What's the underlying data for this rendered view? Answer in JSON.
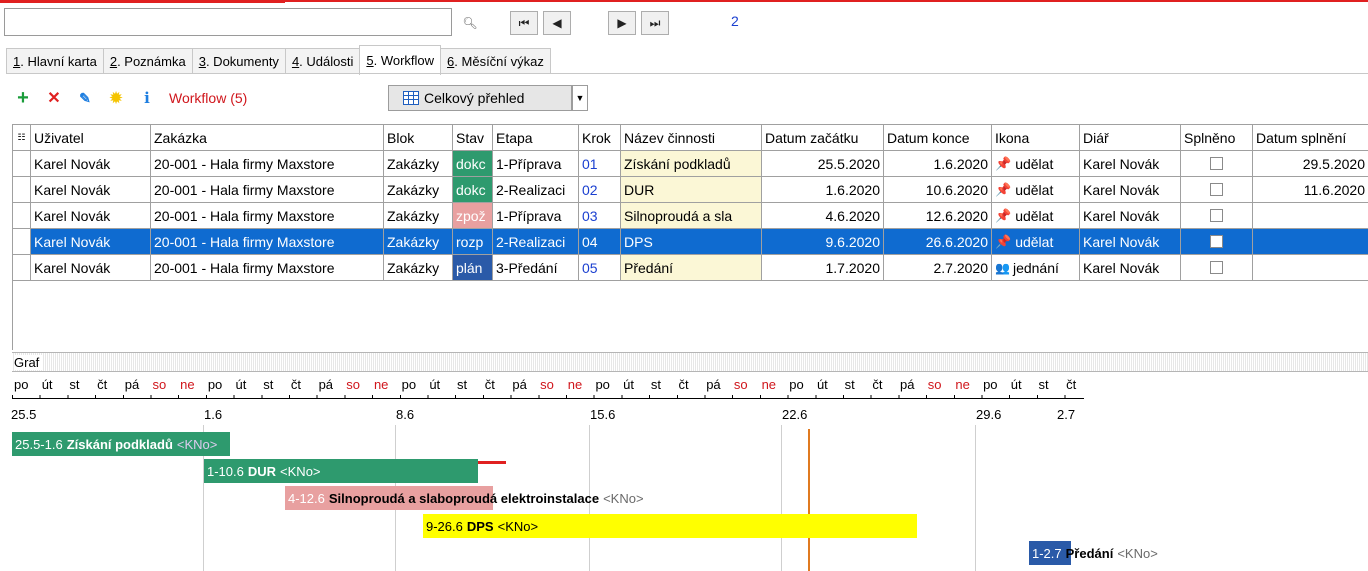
{
  "nav": {
    "page": "2"
  },
  "tabs": [
    {
      "num": "1",
      "label": ". Hlavní karta"
    },
    {
      "num": "2",
      "label": ". Poznámka"
    },
    {
      "num": "3",
      "label": ". Dokumenty"
    },
    {
      "num": "4",
      "label": ". Události"
    },
    {
      "num": "5",
      "label": ". Workflow"
    },
    {
      "num": "6",
      "label": ". Měsíční výkaz"
    }
  ],
  "toolbar": {
    "title": "Workflow (5)",
    "overview": "Celkový přehled"
  },
  "columns": [
    "Uživatel",
    "Zakázka",
    "Blok",
    "Stav",
    "Etapa",
    "Krok",
    "Název činnosti",
    "Datum začátku",
    "Datum konce",
    "Ikona",
    "Diář",
    "Splněno",
    "Datum splnění"
  ],
  "rows": [
    {
      "user": "Karel Novák",
      "order": "20-001 - Hala firmy Maxstore",
      "blok": "Zakázky",
      "stav": "dokc",
      "stav_color": "#2e9a6e",
      "etapa": "1-Příprava",
      "krok": "01",
      "name": "Získání podkladů",
      "start": "25.5.2020",
      "end": "1.6.2020",
      "icon": "udělat",
      "diary": "Karel Novák",
      "done_date": "29.5.2020"
    },
    {
      "user": "Karel Novák",
      "order": "20-001 - Hala firmy Maxstore",
      "blok": "Zakázky",
      "stav": "dokc",
      "stav_color": "#2e9a6e",
      "etapa": "2-Realizaci",
      "krok": "02",
      "name": "DUR",
      "start": "1.6.2020",
      "end": "10.6.2020",
      "icon": "udělat",
      "diary": "Karel Novák",
      "done_date": "11.6.2020"
    },
    {
      "user": "Karel Novák",
      "order": "20-001 - Hala firmy Maxstore",
      "blok": "Zakázky",
      "stav": "zpož",
      "stav_color": "#e8a0a0",
      "etapa": "1-Příprava",
      "krok": "03",
      "name": "Silnoproudá a sla",
      "start": "4.6.2020",
      "end": "12.6.2020",
      "icon": "udělat",
      "diary": "Karel Novák",
      "done_date": ""
    },
    {
      "user": "Karel Novák",
      "order": "20-001 - Hala firmy Maxstore",
      "blok": "Zakázky",
      "stav": "rozp",
      "stav_color": "#0f6bd0",
      "etapa": "2-Realizaci",
      "krok": "04",
      "name": "DPS",
      "start": "9.6.2020",
      "end": "26.6.2020",
      "icon": "udělat",
      "diary": "Karel Novák",
      "done_date": ""
    },
    {
      "user": "Karel Novák",
      "order": "20-001 - Hala firmy Maxstore",
      "blok": "Zakázky",
      "stav": "plán",
      "stav_color": "#2a5aa8",
      "etapa": "3-Předání",
      "krok": "05",
      "name": "Předání",
      "start": "1.7.2020",
      "end": "2.7.2020",
      "icon": "jednání",
      "diary": "Karel Novák",
      "done_date": ""
    }
  ],
  "graf": {
    "label": "Graf",
    "days": [
      "po",
      "út",
      "st",
      "čt",
      "pá",
      "so",
      "ne",
      "po",
      "út",
      "st",
      "čt",
      "pá",
      "so",
      "ne",
      "po",
      "út",
      "st",
      "čt",
      "pá",
      "so",
      "ne",
      "po",
      "út",
      "st",
      "čt",
      "pá",
      "so",
      "ne",
      "po",
      "út",
      "st",
      "čt",
      "pá",
      "so",
      "ne",
      "po",
      "út",
      "st",
      "čt"
    ],
    "weeks": [
      "25.5",
      "1.6",
      "8.6",
      "15.6",
      "22.6",
      "29.6",
      "2.7"
    ],
    "tasks": [
      {
        "dates": "25.5-1.6",
        "name": "Získání podkladů",
        "owner": "<KNo>",
        "color": "#2e9a6e"
      },
      {
        "dates": "1-10.6",
        "name": "DUR",
        "owner": "<KNo>",
        "color": "#2e9a6e"
      },
      {
        "dates": "4-12.6",
        "name": "Silnoproudá a slaboproudá elektroinstalace",
        "owner": "<KNo>",
        "color": "#e8a0a0"
      },
      {
        "dates": "9-26.6",
        "name": "DPS",
        "owner": "<KNo>",
        "color": "#ffff00"
      },
      {
        "dates": "1-2.7",
        "name": "Předání",
        "owner": "<KNo>",
        "color": "#2a5aa8"
      }
    ]
  }
}
